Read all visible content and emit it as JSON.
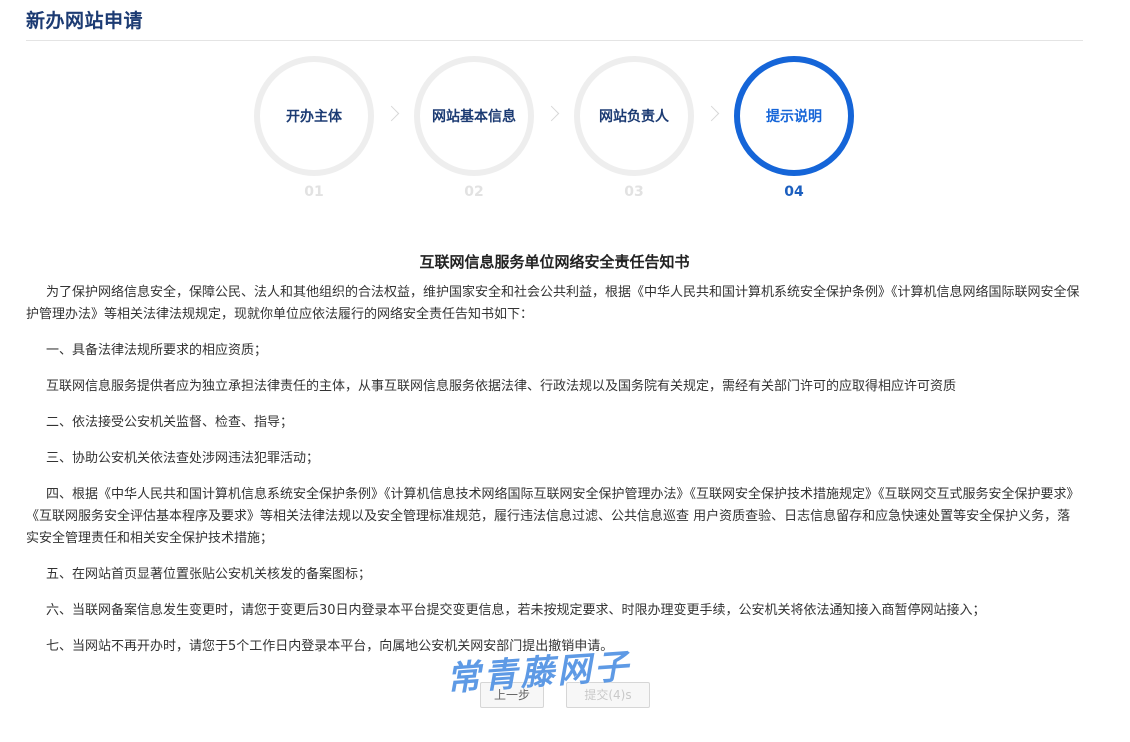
{
  "page": {
    "title": "新办网站申请"
  },
  "steps": [
    {
      "label": "开办主体",
      "number": "01",
      "active": false
    },
    {
      "label": "网站基本信息",
      "number": "02",
      "active": false
    },
    {
      "label": "网站负责人",
      "number": "03",
      "active": false
    },
    {
      "label": "提示说明",
      "number": "04",
      "active": true
    }
  ],
  "notice": {
    "title": "互联网信息服务单位网络安全责任告知书",
    "paragraphs": [
      "为了保护网络信息安全，保障公民、法人和其他组织的合法权益，维护国家安全和社会公共利益，根据《中华人民共和国计算机系统安全保护条例》《计算机信息网络国际联网安全保护管理办法》等相关法律法规规定，现就你单位应依法履行的网络安全责任告知书如下：",
      "一、具备法律法规所要求的相应资质；",
      "互联网信息服务提供者应为独立承担法律责任的主体，从事互联网信息服务依据法律、行政法规以及国务院有关规定，需经有关部门许可的应取得相应许可资质",
      "二、依法接受公安机关监督、检查、指导；",
      "三、协助公安机关依法查处涉网违法犯罪活动；",
      "四、根据《中华人民共和国计算机信息系统安全保护条例》《计算机信息技术网络国际互联网安全保护管理办法》《互联网安全保护技术措施规定》《互联网交互式服务安全保护要求》《互联网服务安全评估基本程序及要求》等相关法律法规以及安全管理标准规范，履行违法信息过滤、公共信息巡查 用户资质查验、日志信息留存和应急快速处置等安全保护义务，落实安全管理责任和相关安全保护技术措施；",
      "五、在网站首页显著位置张贴公安机关核发的备案图标；",
      "六、当联网备案信息发生变更时，请您于变更后30日内登录本平台提交变更信息，若未按规定要求、时限办理变更手续，公安机关将依法通知接入商暂停网站接入；",
      "七、当网站不再开办时，请您于5个工作日内登录本平台，向属地公安机关网安部门提出撤销申请。"
    ]
  },
  "buttons": {
    "prev": "上一步",
    "submit": "提交(4)s"
  },
  "watermark": "常青藤网子",
  "colors": {
    "accent": "#1565d8",
    "title": "#1c3b73"
  }
}
